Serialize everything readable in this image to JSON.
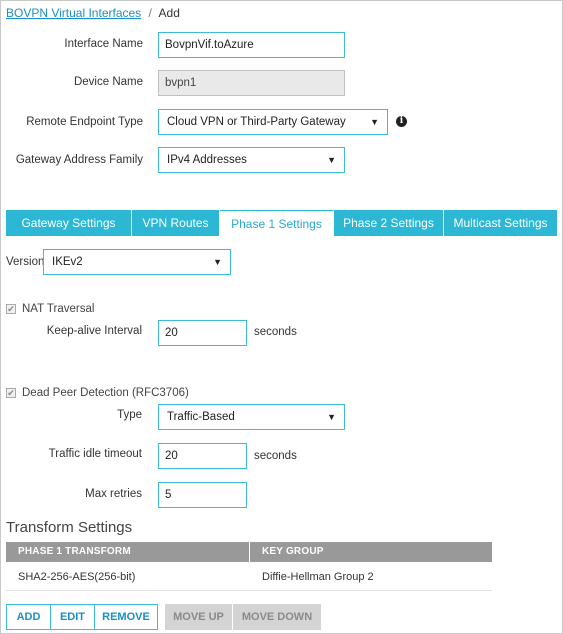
{
  "breadcrumb": {
    "link": "BOVPN Virtual Interfaces",
    "sep": "/",
    "current": "Add"
  },
  "form": {
    "interface_name": {
      "label": "Interface Name",
      "value": "BovpnVif.toAzure"
    },
    "device_name": {
      "label": "Device Name",
      "value": "bvpn1"
    },
    "remote_endpoint": {
      "label": "Remote Endpoint Type",
      "value": "Cloud VPN or Third-Party Gateway"
    },
    "address_family": {
      "label": "Gateway Address Family",
      "value": "IPv4 Addresses"
    }
  },
  "icons": {
    "info": "i",
    "caret": "▼",
    "check": "✔"
  },
  "tabs": [
    "Gateway Settings",
    "VPN Routes",
    "Phase 1 Settings",
    "Phase 2 Settings",
    "Multicast Settings"
  ],
  "phase1": {
    "version": {
      "label": "Version",
      "value": "IKEv2"
    },
    "nat_traversal": {
      "label": "NAT Traversal",
      "checked": true
    },
    "keepalive": {
      "label": "Keep-alive Interval",
      "value": "20",
      "unit": "seconds"
    },
    "dpd": {
      "label": "Dead Peer Detection (RFC3706)",
      "checked": true
    },
    "type": {
      "label": "Type",
      "value": "Traffic-Based"
    },
    "idle_timeout": {
      "label": "Traffic idle timeout",
      "value": "20",
      "unit": "seconds"
    },
    "max_retries": {
      "label": "Max retries",
      "value": "5"
    }
  },
  "transform": {
    "title": "Transform Settings",
    "columns": [
      "PHASE 1 TRANSFORM",
      "KEY GROUP"
    ],
    "rows": [
      {
        "transform": "SHA2-256-AES(256-bit)",
        "key_group": "Diffie-Hellman Group 2"
      }
    ]
  },
  "buttons": {
    "add": "ADD",
    "edit": "EDIT",
    "remove": "REMOVE",
    "move_up": "MOVE UP",
    "move_down": "MOVE DOWN"
  },
  "colors": {
    "accent": "#2cb7d4",
    "link": "#1a8fc4",
    "header_gray": "#999999",
    "disabled": "#d4d4d4"
  }
}
